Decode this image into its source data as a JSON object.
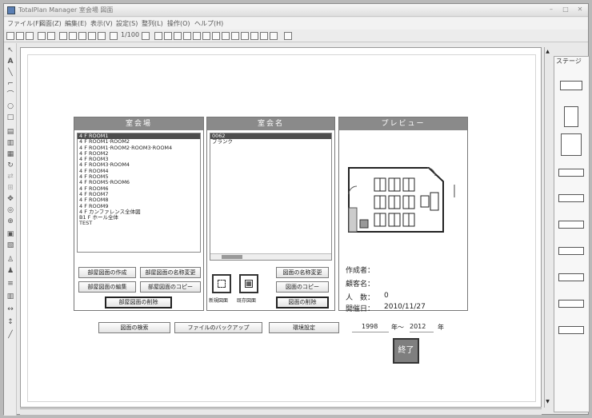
{
  "window": {
    "title": "TotalPlan Manager  室会場  図面"
  },
  "menu": [
    "ファイル(F)",
    "図面(Z)",
    "編集(E)",
    "表示(V)",
    "設定(S)",
    "整列(L)",
    "操作(O)",
    "ヘルプ(H)"
  ],
  "toolbar": {
    "zoom": "1/100"
  },
  "right_panel": {
    "header": "ステージ"
  },
  "room_list": {
    "title": "室会場",
    "items": [
      "4 F  ROOM1",
      "4 F  ROOM1·ROOM2",
      "4 F  ROOM1·ROOM2·ROOM3·ROOM4",
      "4 F  ROOM2",
      "4 F  ROOM3",
      "4 F  ROOM3·ROOM4",
      "4 F  ROOM4",
      "4 F  ROOM5",
      "4 F  ROOM5·ROOM6",
      "4 F  ROOM6",
      "4 F  ROOM7",
      "4 F  ROOM8",
      "4 F  ROOM9",
      "4 F  カンファレンス全体図",
      "B1 F  ホール全体",
      "TEST"
    ],
    "selected": 0,
    "buttons": {
      "create": "部屋図面の作成",
      "rename": "部屋図面の名称変更",
      "edit": "部屋図面の編集",
      "copy": "部屋図面のコピー",
      "delete": "部屋図面の削除"
    }
  },
  "drawing_list": {
    "title": "室会名",
    "items": [
      "0062",
      "ブランク"
    ],
    "selected": 0,
    "new_label": "新規図面",
    "open_label": "既存図面",
    "buttons": {
      "rename": "図面の名称変更",
      "copy": "図面のコピー",
      "delete": "図面の削除"
    }
  },
  "preview": {
    "title": "プレビュー",
    "creator_label": "作成者：",
    "client_label": "顧客名：",
    "count_label": "人　数：",
    "count_value": "0",
    "date_label": "開催日：",
    "date_value": "2010/11/27"
  },
  "footer": {
    "search": "図面の検索",
    "backup": "ファイルのバックアップ",
    "settings": "環境設定",
    "year_from": "1998",
    "year_sep": "年～",
    "year_to": "2012",
    "year_suffix": "年",
    "end": "終了"
  }
}
